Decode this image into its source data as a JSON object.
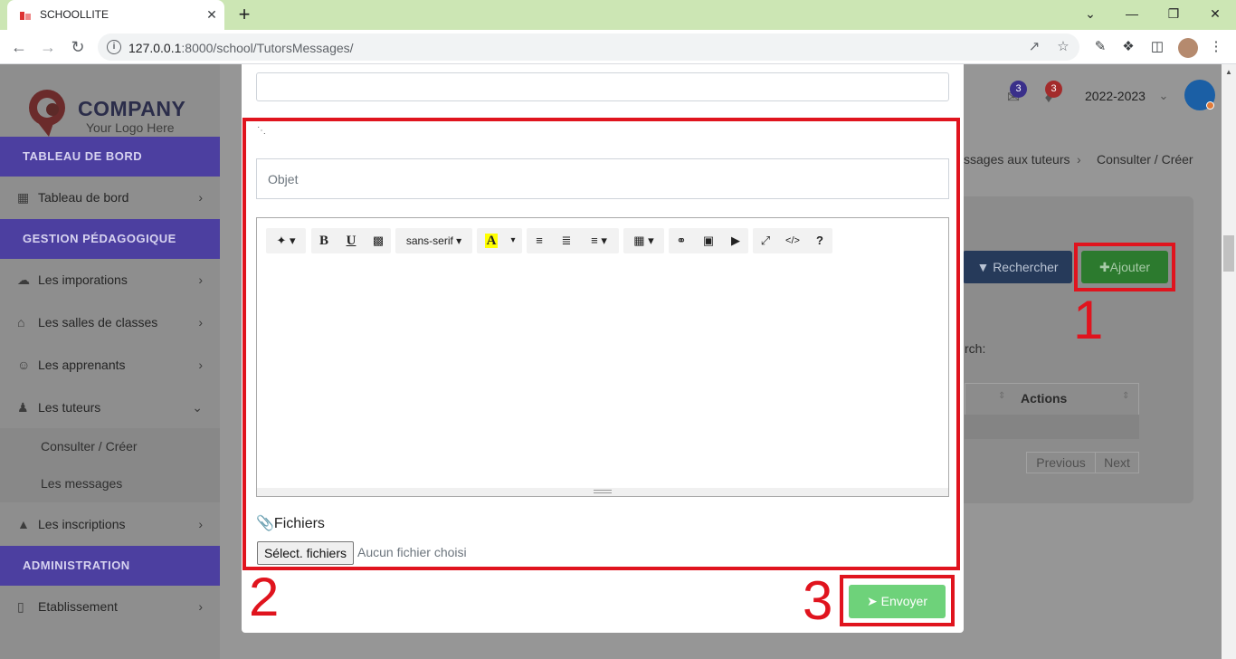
{
  "browser": {
    "tab_title": "SCHOOLLITE",
    "tab_close": "✕",
    "new_tab": "+",
    "url_host": "127.0.0.1",
    "url_rest": ":8000/school/TutorsMessages/",
    "window_controls": [
      "minimize",
      "restore",
      "close"
    ]
  },
  "header": {
    "messages_badge": "3",
    "notifications_badge": "3",
    "school_year": "2022-2023"
  },
  "logo": {
    "name": "COMPANY",
    "tagline": "Your Logo Here"
  },
  "sidebar": {
    "sections": [
      "TABLEAU DE BORD",
      "GESTION PÉDAGOGIQUE",
      "ADMINISTRATION"
    ],
    "items": [
      {
        "label": "Tableau de bord",
        "icon": "grid-icon"
      },
      {
        "label": "Les imporations",
        "icon": "cloud-upload-icon"
      },
      {
        "label": "Les salles de classes",
        "icon": "home-icon"
      },
      {
        "label": "Les apprenants",
        "icon": "users-icon"
      },
      {
        "label": "Les tuteurs",
        "icon": "user-icon"
      },
      {
        "label": "Les inscriptions",
        "icon": "graduation-cap-icon"
      },
      {
        "label": "Etablissement",
        "icon": "building-icon"
      }
    ],
    "sub_items": [
      "Consulter / Créer",
      "Les messages"
    ]
  },
  "breadcrumb": {
    "partial": "ssages aux tuteurs",
    "current": "Consulter / Créer"
  },
  "background_card": {
    "search_button": "Rechercher",
    "add_button": "✚Ajouter",
    "search_label": "rch:",
    "actions_header": "Actions",
    "previous": "Previous",
    "next": "Next"
  },
  "modal": {
    "subject_placeholder": "Objet",
    "toolbar": {
      "font_name": "sans-serif",
      "buttons": [
        "magic-icon",
        "bold-icon",
        "underline-icon",
        "eraser-icon",
        "font-name-dropdown",
        "text-color-icon",
        "unordered-list-icon",
        "ordered-list-icon",
        "align-icon",
        "table-icon",
        "link-icon",
        "picture-icon",
        "video-icon",
        "fullscreen-icon",
        "code-view-icon",
        "help-icon"
      ]
    },
    "files_label": "Fichiers",
    "file_button": "Sélect. fichiers",
    "file_none": "Aucun fichier choisi",
    "send_button": "Envoyer"
  },
  "annotations": [
    "1",
    "2",
    "3"
  ],
  "colors": {
    "annotation": "#e0141e",
    "send": "#6ed27a",
    "sidebar_section": "#4c3fa0",
    "tab_strip": "#cce6b4"
  }
}
